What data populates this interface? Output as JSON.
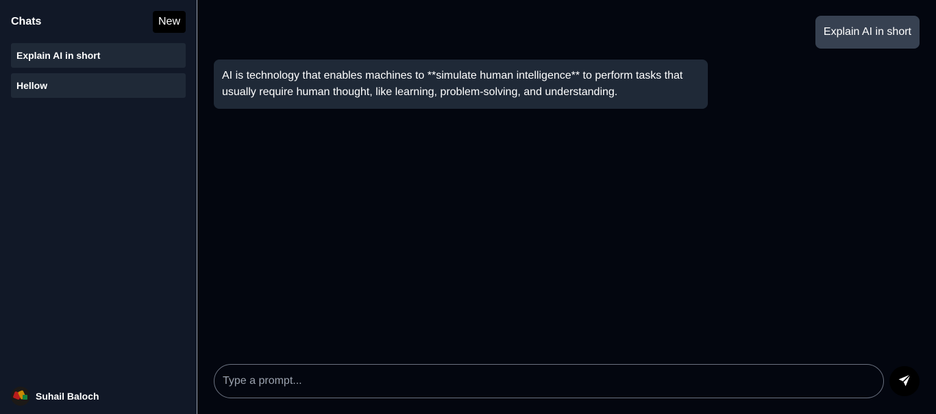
{
  "sidebar": {
    "title": "Chats",
    "new_label": "New",
    "chats": [
      {
        "label": "Explain AI in short"
      },
      {
        "label": "Hellow"
      }
    ],
    "user": {
      "name": "Suhail Baloch",
      "avatar_icon": "user-avatar-image"
    }
  },
  "conversation": {
    "user_message": "Explain AI in short",
    "ai_message": "AI is technology that enables machines to **simulate human intelligence** to perform tasks that usually require human thought, like learning, problem-solving, and understanding."
  },
  "composer": {
    "placeholder": "Type a prompt...",
    "send_icon": "paper-plane-icon"
  },
  "colors": {
    "sidebar_bg": "#111827",
    "main_bg": "#03060f",
    "user_bubble": "#374151",
    "ai_bubble": "#1f2937",
    "chat_item_bg": "#1f2937",
    "button_bg": "#000000"
  }
}
